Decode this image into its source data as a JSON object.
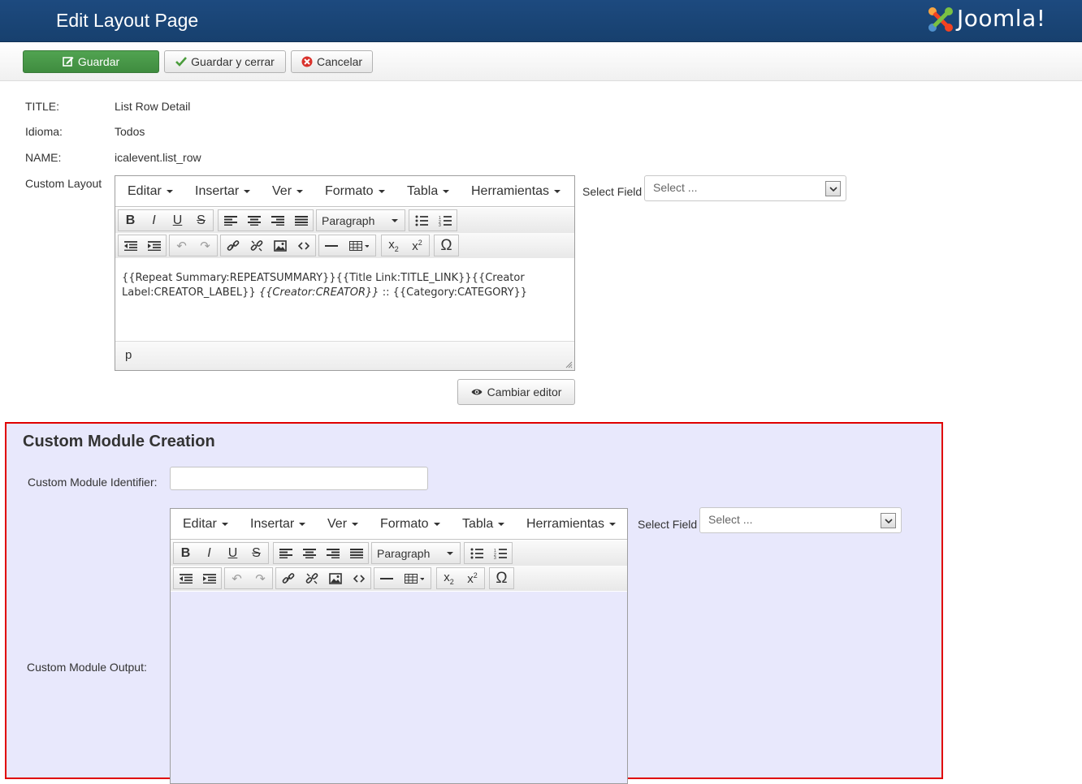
{
  "header": {
    "title": "Edit Layout Page",
    "brand": "Joomla!"
  },
  "toolbar": {
    "save": "Guardar",
    "save_close": "Guardar y cerrar",
    "cancel": "Cancelar"
  },
  "fields": {
    "title_label": "TITLE:",
    "title_value": "List Row Detail",
    "language_label": "Idioma:",
    "language_value": "Todos",
    "name_label": "NAME:",
    "name_value": "icalevent.list_row",
    "custom_layout_label": "Custom Layout"
  },
  "editor": {
    "menu": [
      "Editar",
      "Insertar",
      "Ver",
      "Formato",
      "Tabla",
      "Herramientas"
    ],
    "format_select": "Paragraph",
    "content": {
      "t1": "{{Repeat Summary:REPEATSUMMARY}}{{Title Link:TITLE_LINK}}{{Creator",
      "t2": "Label:CREATOR_LABEL}} ",
      "t3": "{{Creator:CREATOR}}",
      "t4": " :: {{Category:CATEGORY}}"
    },
    "path": "p"
  },
  "select_field": {
    "label": "Select Field",
    "placeholder": "Select ..."
  },
  "change_editor": "Cambiar editor",
  "module": {
    "heading": "Custom Module Creation",
    "identifier_label": "Custom Module Identifier:",
    "identifier_value": "",
    "output_label": "Custom Module Output:"
  },
  "colors": {
    "header": "#1d4a7f",
    "save": "#51a351",
    "module_bg": "#e8e8fc",
    "module_border": "#e00000"
  }
}
